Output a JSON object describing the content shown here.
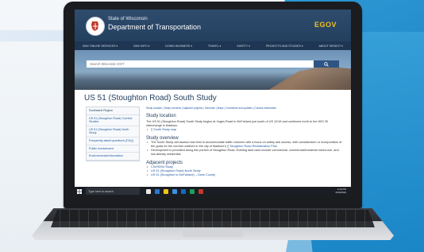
{
  "colors": {
    "header_bg": "#23405f",
    "nav_bg": "#1e3653",
    "link": "#1f5aa0",
    "brand_yellow": "#f2c21b",
    "backdrop_blue": "#1f8fd1"
  },
  "header": {
    "state": "State of Wisconsin",
    "department": "Department of Transportation",
    "badge": "EGOV"
  },
  "nav": {
    "items": [
      {
        "label": "DMV ONLINE SERVICES ▾"
      },
      {
        "label": "DMV INFO ▾"
      },
      {
        "label": "DOING BUSINESS ▾"
      },
      {
        "label": "TRAVEL ▾"
      },
      {
        "label": "SAFETY ▾"
      },
      {
        "label": "PROJECTS AND STUDIES ▾"
      },
      {
        "label": "ABOUT WISDOT ▾"
      }
    ]
  },
  "search": {
    "placeholder": "Search Wisconsin DOT",
    "button_icon": "search-icon"
  },
  "page": {
    "title": "US 51 (Stoughton Road) South Study",
    "breadcrumbs": "Study location | Study overview | Adjacent projects | Schedule | Maps | Comments and updates | Contact information"
  },
  "sidebar": {
    "items": [
      {
        "label": "Southwest Region"
      },
      {
        "label": "US 51 (Stoughton Road) Corridor Studies"
      },
      {
        "label": "US 51 (Stoughton Road) North Study"
      },
      {
        "label": "Frequently asked questions (FAQ)"
      },
      {
        "label": "Public involvement"
      },
      {
        "label": "Environmental information"
      }
    ]
  },
  "sections": {
    "location_heading": "Study location",
    "location_text": "The US 51 (Stoughton Road) South Study begins at Voges Road in McFarland just south of US 12/18 and continues north to the WIS 30 interchange in Madison.",
    "location_link": "South Study map",
    "overview_heading": "Study overview",
    "overview_bullet1_a": "The South Study will assess how best to accommodate traffic volumes with a focus on safety and access, with consideration or incorporation of the goals for the corridor outlined in the city of Madison's",
    "overview_bullet1_link": "Stoughton Road Revitalization Plan",
    "overview_bullet1_b": ".",
    "overview_bullet2": "Development is prevalent along this portion of Stoughton Road. Existing land uses include commercial, commercial/industrial mixed-use, and low-density residential.",
    "adjacent_heading": "Adjacent projects",
    "adjacent_items": [
      {
        "label": "I-39/90/94 Study"
      },
      {
        "label": "US 51 (Stoughton Road) North Study"
      },
      {
        "label": "US 51 (Stoughton to McFarland) – Dane County"
      }
    ]
  },
  "taskbar": {
    "search_placeholder": "Type here to search",
    "time": "2:10 PM",
    "date": "6/30/2019"
  }
}
